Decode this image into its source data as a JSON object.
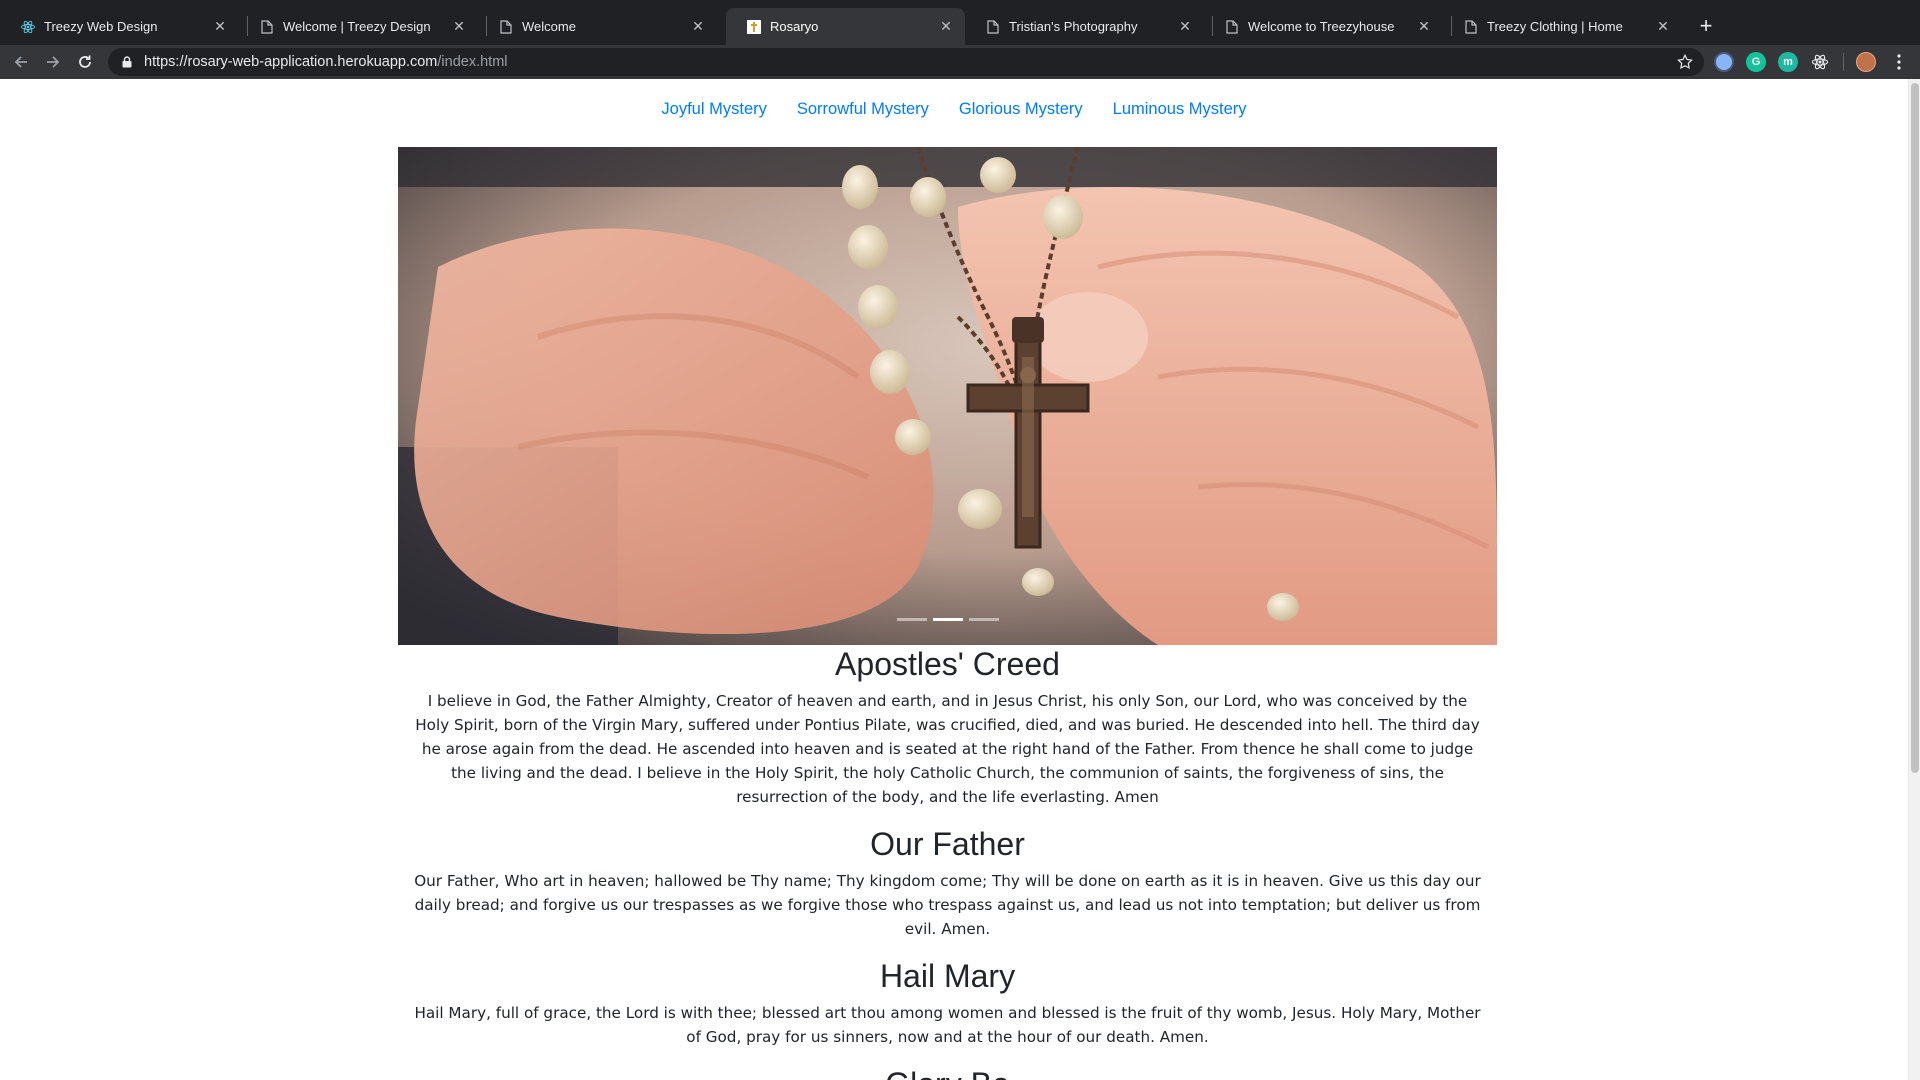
{
  "browser": {
    "tabs": [
      {
        "title": "Treezy Web Design",
        "favicon": "react-icon",
        "active": false
      },
      {
        "title": "Welcome | Treezy Design",
        "favicon": "page-icon",
        "active": false
      },
      {
        "title": "Welcome",
        "favicon": "page-icon",
        "active": false
      },
      {
        "title": "Rosaryo",
        "favicon": "rosaryo-icon",
        "active": true
      },
      {
        "title": "Tristian's Photography",
        "favicon": "page-icon",
        "active": false
      },
      {
        "title": "Welcome to Treezyhouse",
        "favicon": "page-icon",
        "active": false
      },
      {
        "title": "Treezy Clothing | Home",
        "favicon": "page-icon",
        "active": false
      }
    ],
    "url": {
      "host": "https://rosary-web-application.herokuapp.com",
      "path": "/index.html"
    },
    "extensions": [
      "extension-blue-icon",
      "grammarly-icon",
      "extension-m-icon",
      "react-devtools-icon",
      "profile-avatar"
    ]
  },
  "nav": {
    "links": [
      "Joyful Mystery",
      "Sorrowful Mystery",
      "Glorious Mystery",
      "Luminous Mystery"
    ]
  },
  "carousel": {
    "slides": 3,
    "active_slide": 2
  },
  "prayers": [
    {
      "title": "Apostles' Creed",
      "text": "I believe in God, the Father Almighty, Creator of heaven and earth, and in Jesus Christ, his only Son, our Lord, who was conceived by the Holy Spirit, born of the Virgin Mary, suffered under Pontius Pilate, was crucified, died, and was buried. He descended into hell. The third day he arose again from the dead. He ascended into heaven and is seated at the right hand of the Father. From thence he shall come to judge the living and the dead. I believe in the Holy Spirit, the holy Catholic Church, the communion of saints, the forgiveness of sins, the resurrection of the body, and the life everlasting. Amen"
    },
    {
      "title": "Our Father",
      "text": "Our Father, Who art in heaven; hallowed be Thy name; Thy kingdom come; Thy will be done on earth as it is in heaven. Give us this day our daily bread; and forgive us our trespasses as we forgive those who trespass against us, and lead us not into temptation; but deliver us from evil. Amen."
    },
    {
      "title": "Hail Mary",
      "text": "Hail Mary, full of grace, the Lord is with thee; blessed art thou among women and blessed is the fruit of thy womb, Jesus. Holy Mary, Mother of God, pray for us sinners, now and at the hour of our death. Amen."
    },
    {
      "title": "Glory Be",
      "text": ""
    }
  ],
  "colors": {
    "link": "#007bff",
    "text": "#212529",
    "chrome_dark": "#202124",
    "chrome_toolbar": "#35363a"
  }
}
